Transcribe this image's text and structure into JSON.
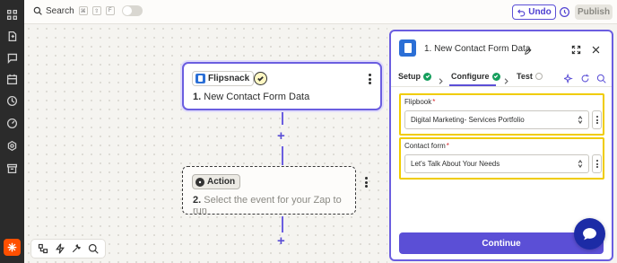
{
  "topbar": {
    "search_label": "Search",
    "shortcut_keys": [
      "⌘",
      "⇧",
      "F"
    ],
    "undo_label": "Undo",
    "publish_label": "Publish"
  },
  "rail": {
    "icons": [
      "apps-icon",
      "document-icon",
      "chat-icon",
      "calendar-icon",
      "history-icon",
      "dashboard-icon",
      "settings-icon",
      "archive-icon"
    ]
  },
  "canvas": {
    "step1": {
      "app_name": "Flipsnack",
      "number": "1.",
      "title": "New Contact Form Data"
    },
    "step2": {
      "chip_label": "Action",
      "number": "2.",
      "title": "Select the event for your Zap to run"
    }
  },
  "panel": {
    "title": "1. New Contact Form Data",
    "tabs": [
      {
        "label": "Setup",
        "status": "complete"
      },
      {
        "label": "Configure",
        "status": "complete"
      },
      {
        "label": "Test",
        "status": "pending"
      }
    ],
    "fields": [
      {
        "label": "Flipbook",
        "required_mark": "*",
        "value": "Digital Marketing- Services Portfolio"
      },
      {
        "label": "Contact form",
        "required_mark": "*",
        "value": "Let's Talk About Your Needs"
      }
    ],
    "continue_label": "Continue"
  },
  "colors": {
    "accent": "#5b4fd6",
    "highlight": "#f0cc00",
    "success": "#159e5c",
    "brand_zap": "#ff4f00"
  }
}
